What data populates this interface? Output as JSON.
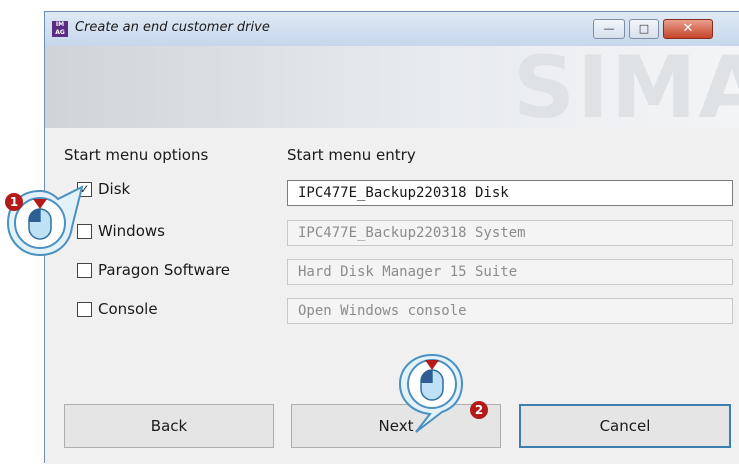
{
  "window": {
    "title": "Create an end customer drive",
    "app_icon_text": "IMAGE"
  },
  "title_buttons": {
    "minimize": "—",
    "maximize": "□",
    "close": "✕"
  },
  "banner": {
    "brand": "SIMA"
  },
  "columns": {
    "options_header": "Start menu options",
    "entry_header": "Start menu entry"
  },
  "options": [
    {
      "label": "Disk",
      "checked": true,
      "entry": "IPC477E_Backup220318 Disk",
      "active": true
    },
    {
      "label": "Windows",
      "checked": false,
      "entry": "IPC477E_Backup220318 System",
      "active": false
    },
    {
      "label": "Paragon Software",
      "checked": false,
      "entry": "Hard Disk Manager 15 Suite",
      "active": false
    },
    {
      "label": "Console",
      "checked": false,
      "entry": "Open Windows console",
      "active": false
    }
  ],
  "buttons": {
    "back": "Back",
    "next": "Next",
    "cancel": "Cancel"
  },
  "callouts": {
    "first": "1",
    "second": "2"
  },
  "checkmark": "✓"
}
